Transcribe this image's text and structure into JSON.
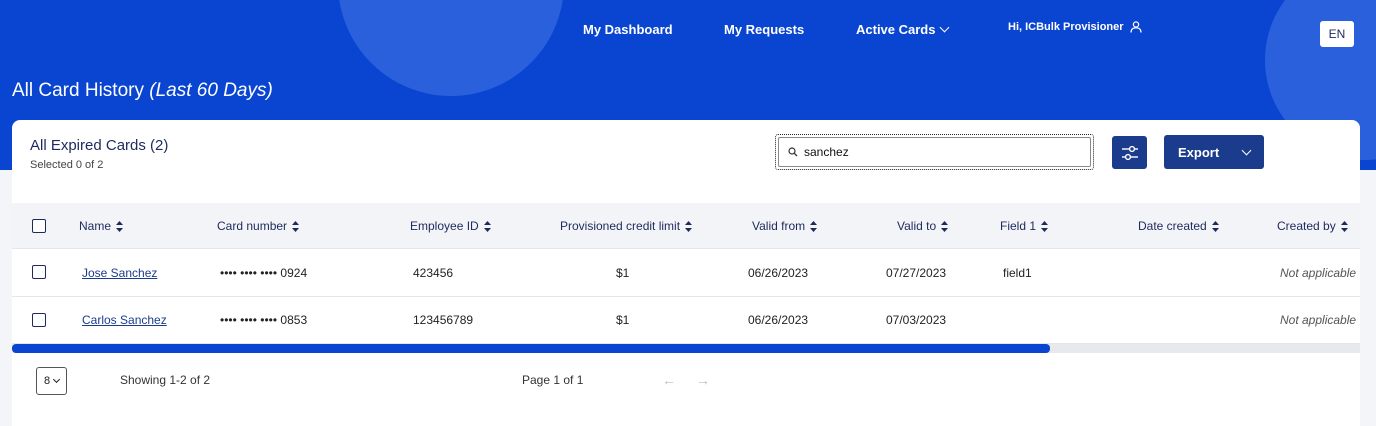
{
  "nav": {
    "dashboard": "My Dashboard",
    "requests": "My Requests",
    "active_cards": "Active Cards",
    "greeting": "Hi, ICBulk Provisioner",
    "language": "EN"
  },
  "page": {
    "title": "All Card History",
    "title_suffix": "(Last 60 Days)"
  },
  "card": {
    "title": "All Expired Cards (2)",
    "selected": "Selected 0 of 2",
    "search_value": "sanchez",
    "export_label": "Export"
  },
  "table": {
    "columns": [
      "Name",
      "Card number",
      "Employee ID",
      "Provisioned credit limit",
      "Valid from",
      "Valid to",
      "Field 1",
      "Date created",
      "Created by"
    ],
    "rows": [
      {
        "name": "Jose Sanchez",
        "card": "•••• •••• •••• 0924",
        "employee_id": "423456",
        "limit": "$1",
        "valid_from": "06/26/2023",
        "valid_to": "07/27/2023",
        "field1": "field1",
        "date_created": "",
        "created_by": "Not applicable"
      },
      {
        "name": "Carlos Sanchez",
        "card": "•••• •••• •••• 0853",
        "employee_id": "123456789",
        "limit": "$1",
        "valid_from": "06/26/2023",
        "valid_to": "07/03/2023",
        "field1": "",
        "date_created": "",
        "created_by": "Not applicable"
      }
    ]
  },
  "scrollbar": {
    "thumb_fraction": 0.77
  },
  "pagination": {
    "page_size": "8",
    "showing": "Showing 1-2 of 2",
    "page_info": "Page 1 of 1",
    "prev": "←",
    "next": "→"
  },
  "colors": {
    "banner": "#0a45d1",
    "primary_button": "#1b3b8c",
    "text_dark": "#1d2a5c"
  }
}
